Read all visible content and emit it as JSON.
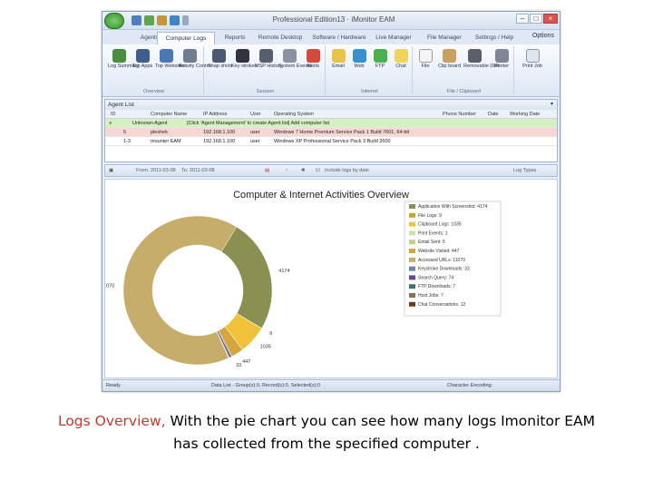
{
  "window": {
    "title": "Professional Edition13 · iMonitor EAM"
  },
  "tabs": [
    "Agents",
    "Computer Logs",
    "Reports",
    "Remote Desktop",
    "Software / Hardware",
    "Live Manager",
    "File Manager",
    "Settings / Help"
  ],
  "options_label": "Options",
  "ribbon": {
    "groups": [
      {
        "label": "Overview",
        "buttons": [
          "Log Summary",
          "Top Apps",
          "Top Websites",
          "Activity Control"
        ]
      },
      {
        "label": "Session",
        "buttons": [
          "Snap shots",
          "Key strokes",
          "MSP History",
          "System Events",
          "Alerts"
        ]
      },
      {
        "label": "Internet",
        "buttons": [
          "Email",
          "Web",
          "FTP",
          "Chat"
        ]
      },
      {
        "label": "File / Clipboard",
        "buttons": [
          "File",
          "Clip board",
          "Removable Disk",
          "Printer"
        ]
      },
      {
        "label": "",
        "buttons": [
          "Print Job"
        ]
      }
    ]
  },
  "agent_list": {
    "title": "Agent List",
    "columns": [
      "ID",
      "Computer Name",
      "IP Address",
      "User",
      "Operating System",
      "Phone Number",
      "Date",
      "Working Date"
    ],
    "rows": [
      {
        "id": "",
        "name": "Unknown Agent",
        "ip": "[Click 'Agent Management' to create Agent list] Add computer list",
        "user": "",
        "os": "",
        "phone": "",
        "color": "#d7f0c2"
      },
      {
        "id": "5",
        "name": "pleshek",
        "ip": "192.168.1.100",
        "user": "user",
        "os": "Windows 7 Home Premium Service Pack 1 Build 7601, 64-bit",
        "phone": "",
        "color": "#f9d6d6"
      },
      {
        "id": "1-3",
        "name": "mounter EAM",
        "ip": "192.168.1.100",
        "user": "user",
        "os": "Windows XP Professional Service Pack 3 Build 2600",
        "phone": "",
        "color": "#ffffff"
      }
    ]
  },
  "report_toolbar": {
    "from_label": "From: 2011-03-08",
    "to_label": "To: 2011-03-08",
    "checkbox_label": "Include logs by date",
    "log_types_label": "Log Types"
  },
  "chart_data": {
    "type": "pie",
    "title": "Computer & Internet Activities Overview",
    "donut": true,
    "labels": [
      "Application With Screenshot",
      "File Logs",
      "Clipboard Logs",
      "Print Events",
      "Email Sent",
      "Website Visited",
      "Accessed URLs",
      "Keystroke Downloads",
      "Search Query",
      "FTP Downloads",
      "Host Jobs",
      "Chat Conversations"
    ],
    "legend_entries": [
      "Application With Screenshot: 4174",
      "File Logs: 9",
      "Clipboard Logs: 1035",
      "Print Events: 1",
      "Email Sent: 5",
      "Website Visited: 447",
      "Accessed URLs: 11070",
      "Keystroke Downloads: 33",
      "Search Query: 74",
      "FTP Downloads: 7",
      "Host Jobs: 7",
      "Chat Conversations: 12"
    ],
    "values": [
      4174,
      9,
      1035,
      1,
      5,
      447,
      11070,
      33,
      74,
      7,
      7,
      12
    ],
    "data_labels": [
      "4174",
      "9",
      "1035",
      "447",
      "33",
      "11070"
    ],
    "colors": [
      "#8c8f52",
      "#c8a62c",
      "#f0c23a",
      "#cfe0a8",
      "#bcd08a",
      "#d6a63e",
      "#c7ad6a",
      "#6d87a8",
      "#5e4f86",
      "#3d7565",
      "#8c6f4d",
      "#6b3e1e"
    ],
    "legend_position": "right"
  },
  "statusbar": {
    "ready": "Ready",
    "data_list": "Data List - Group(s):0, Record(s):0, Selected(s):0",
    "encoding": "Character Encoding:"
  },
  "caption": {
    "highlight": "Logs Overview,",
    "line1_rest": " With the pie chart you can see how many logs Imonitor EAM",
    "line2": "has collected from the specified computer ."
  }
}
